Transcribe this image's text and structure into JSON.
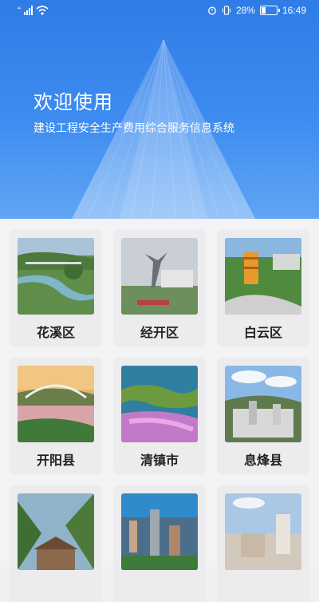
{
  "status_bar": {
    "signal_prefix": "“",
    "battery_percent": "28%",
    "time": "16:49",
    "icons": [
      "signal-icon",
      "wifi-icon",
      "alarm-icon",
      "vibrate-icon",
      "battery-icon"
    ]
  },
  "header": {
    "title": "欢迎使用",
    "subtitle": "建设工程安全生产费用综合服务信息系统"
  },
  "districts": [
    {
      "label": "花溪区"
    },
    {
      "label": "经开区"
    },
    {
      "label": "白云区"
    },
    {
      "label": "开阳县"
    },
    {
      "label": "清镇市"
    },
    {
      "label": "息烽县"
    },
    {
      "label": ""
    },
    {
      "label": ""
    },
    {
      "label": ""
    }
  ],
  "colors": {
    "header_blue": "#2f7ce6",
    "card_bg": "#ececee"
  }
}
